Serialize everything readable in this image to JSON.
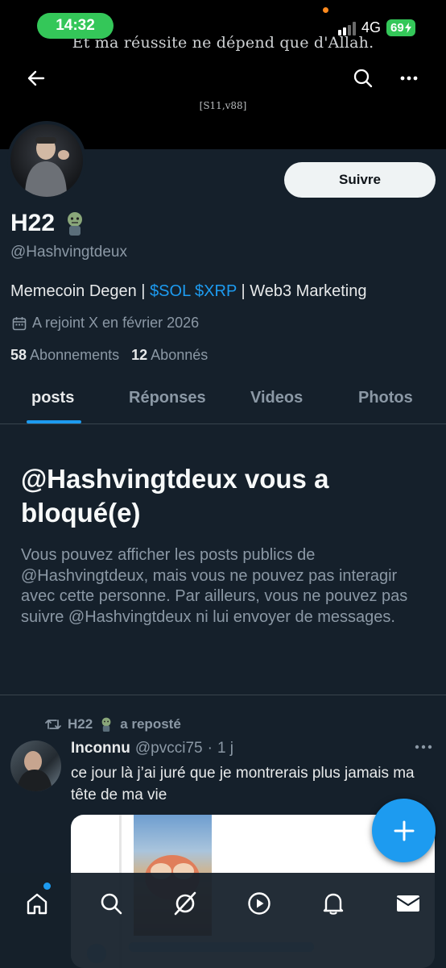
{
  "status_bar": {
    "time": "14:32",
    "network": "4G",
    "battery": "69"
  },
  "banner": {
    "quote": "Et ma réussite ne dépend  que d'Allah.",
    "reference": "[S11,v88]"
  },
  "profile": {
    "name": "H22",
    "handle": "@Hashvingtdeux",
    "bio_prefix": "Memecoin Degen | ",
    "bio_tag1": "$SOL",
    "bio_tag2": "$XRP",
    "bio_suffix": " | Web3 Marketing",
    "joined": "A rejoint X en février 2026",
    "following_count": "58",
    "following_label": "Abonnements",
    "followers_count": "12",
    "followers_label": "Abonnés",
    "follow_button": "Suivre"
  },
  "tabs": [
    {
      "label": "posts"
    },
    {
      "label": "Réponses"
    },
    {
      "label": "Videos"
    },
    {
      "label": "Photos"
    }
  ],
  "blocked": {
    "title": "@Hashvingtdeux vous a bloqué(e)",
    "message": "Vous pouvez afficher les posts publics de @Hashvingtdeux, mais vous ne pouvez pas interagir avec cette personne. Par ailleurs, vous ne pouvez pas suivre @Hashvingtdeux ni lui envoyer de messages."
  },
  "tweet": {
    "repost_by": "H22",
    "repost_label": "a reposté",
    "author_name": "Inconnu",
    "author_handle": "@pvcci75",
    "time": "1 j",
    "text": "ce jour là j’ai juré que je montrerais plus jamais ma tête de ma vie"
  },
  "icons": {
    "back": "arrow-left-icon",
    "search": "search-icon",
    "more": "more-horizontal-icon",
    "calendar": "calendar-icon",
    "repost": "repost-icon",
    "compose": "plus-icon",
    "nav": [
      "home-icon",
      "search-icon",
      "grok-icon",
      "play-icon",
      "bell-icon",
      "mail-icon"
    ]
  },
  "colors": {
    "accent": "#1d9bf0",
    "background": "#15202b",
    "status_green": "#34c759"
  }
}
